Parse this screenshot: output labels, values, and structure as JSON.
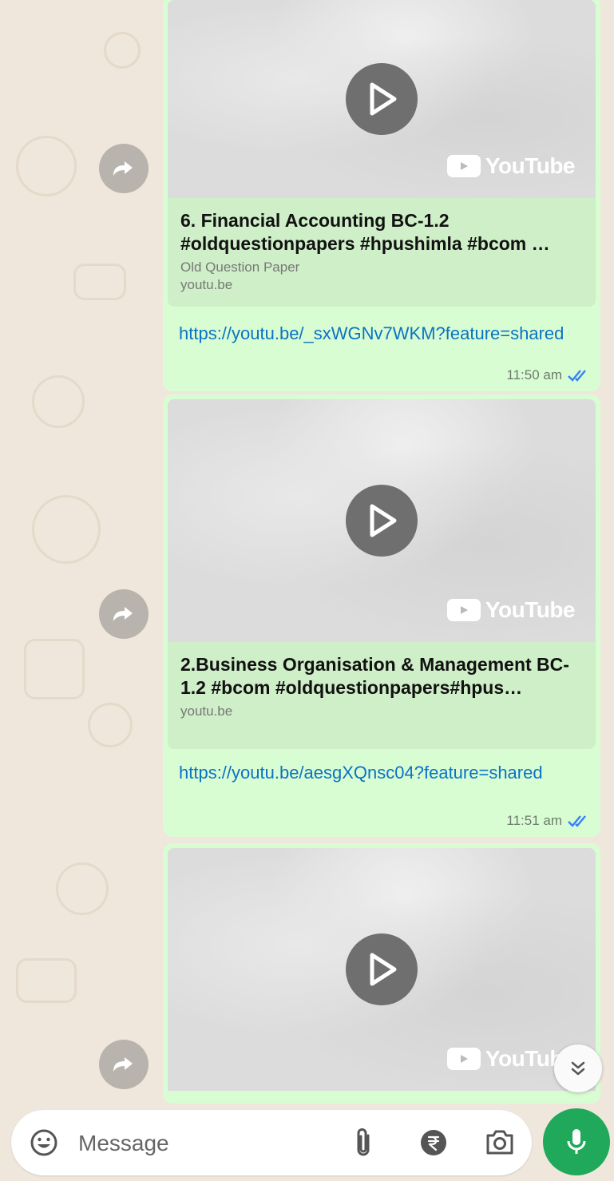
{
  "messages": [
    {
      "title": "6. Financial Accounting BC-1.2 #oldquestionpapers #hpushimla #bcom …",
      "subtitle": "Old Question Paper",
      "domain": "youtu.be",
      "link": "https://youtu.be/_sxWGNv7WKM?feature=shared",
      "time": "11:50 am",
      "youtube_label": "YouTube"
    },
    {
      "title": "2.Business Organisation & Management BC-1.2 #bcom #oldquestionpapers#hpus…",
      "domain": "youtu.be",
      "link": "https://youtu.be/aesgXQnsc04?feature=shared",
      "time": "11:51 am",
      "youtube_label": "YouTube"
    },
    {
      "youtube_label": "YouTube"
    }
  ],
  "composer": {
    "placeholder": "Message"
  },
  "colors": {
    "bubble": "#d9fdd3",
    "link": "#0a73c4",
    "mic": "#20a95a",
    "read_ticks": "#3b82f6"
  },
  "icons": [
    "forward-icon",
    "play-icon",
    "youtube-icon",
    "double-check-icon",
    "chevron-down-double-icon",
    "emoji-icon",
    "attach-icon",
    "rupee-icon",
    "camera-icon",
    "mic-icon"
  ]
}
